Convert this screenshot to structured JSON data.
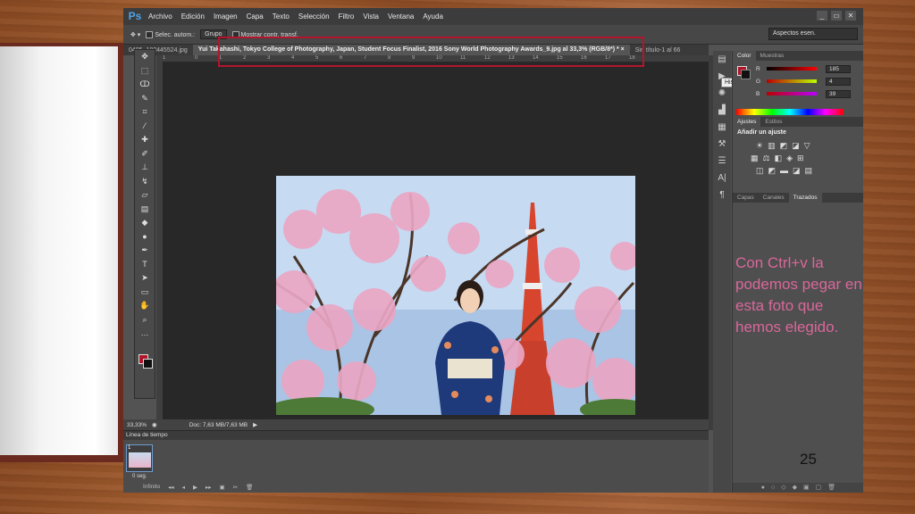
{
  "app": {
    "logo": "Ps",
    "menu": [
      "Archivo",
      "Edición",
      "Imagen",
      "Capa",
      "Texto",
      "Selección",
      "Filtro",
      "Vista",
      "Ventana",
      "Ayuda"
    ],
    "window_buttons": [
      "_",
      "▭",
      "✕"
    ]
  },
  "options_bar": {
    "auto_select_label": "Selec. autom.:",
    "auto_select_value": "Grupo",
    "show_transform_label": "Mostrar contr. transf.",
    "workspace": "Aspectos esen."
  },
  "tabs": {
    "left": "0405_182445524.jpg",
    "active": "Yui Takahashi, Tokyo College of Photography, Japan, Student Focus Finalist, 2016 Sony World Photography Awards_9.jpg al 33,3% (RGB/8*) *",
    "close": "×",
    "right": "Sin título-1 al 66"
  },
  "ruler_ticks": [
    "1",
    "0",
    "1",
    "2",
    "3",
    "4",
    "5",
    "6",
    "7",
    "8",
    "9",
    "10",
    "11",
    "12",
    "13",
    "14",
    "15",
    "16",
    "17",
    "18"
  ],
  "status": {
    "zoom": "33,33%",
    "doc": "Doc: 7,63 MB/7,63 MB"
  },
  "timeline": {
    "title": "Línea de tiempo",
    "frame_number": "1",
    "frame_delay": "0 seg.",
    "loop": "Infinito",
    "controls": [
      "◂◂",
      "◂",
      "▶",
      "▸▸",
      "▣",
      "✂",
      "🗑"
    ]
  },
  "tooltip": "Historia",
  "panels": {
    "color_tabs": [
      "Color",
      "Muestras"
    ],
    "rgb": [
      {
        "label": "R",
        "value": "185"
      },
      {
        "label": "G",
        "value": "4"
      },
      {
        "label": "B",
        "value": "39"
      }
    ],
    "adjust_tabs": [
      "Ajustes",
      "Estilos"
    ],
    "adjust_title": "Añadir un ajuste",
    "adjust_rows": [
      [
        "☀",
        "▥",
        "◩",
        "◪",
        "▽"
      ],
      [
        "▦",
        "⚖",
        "◧",
        "◈",
        "⊞"
      ],
      [
        "◫",
        "◩",
        "▬",
        "◪",
        "▤"
      ]
    ],
    "layer_tabs": [
      "Capas",
      "Canales",
      "Trazados"
    ],
    "footer_icons": [
      "●",
      "○",
      "◇",
      "◆",
      "▣",
      "▢",
      "🗑"
    ]
  },
  "annotation": "Con  Ctrl+v la podemos pegar en esta foto que hemos elegido.",
  "slide_number": "25",
  "colors": {
    "foreground": "#b0152a",
    "highlight": "#b3152c",
    "annotation": "#d9679a"
  }
}
